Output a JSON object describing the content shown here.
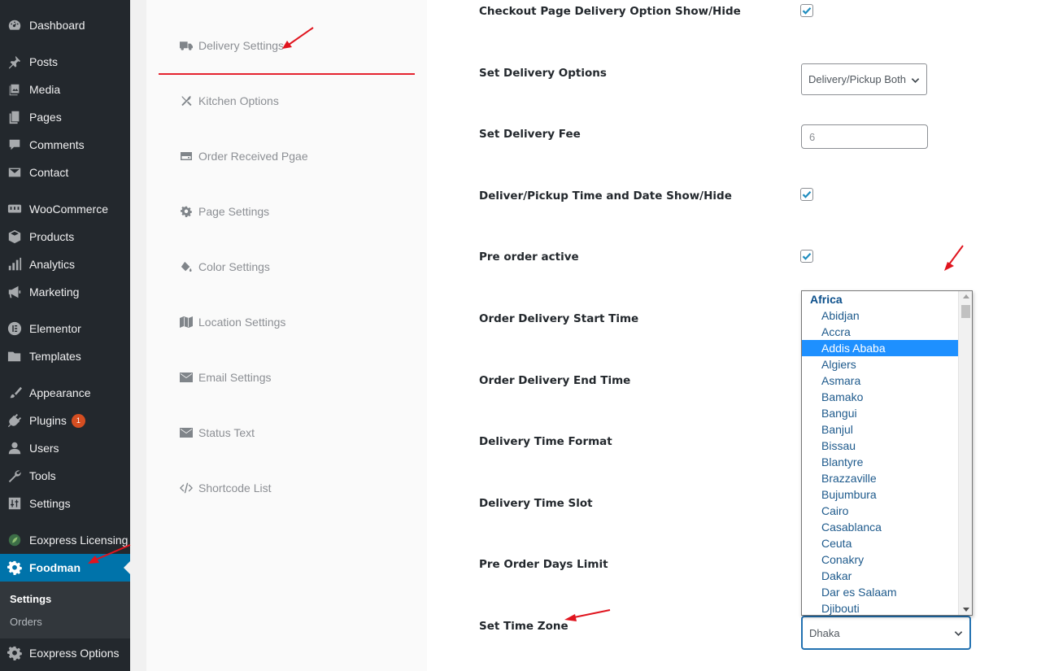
{
  "sidebar": {
    "items": [
      {
        "label": "Dashboard",
        "icon": "dashboard-icon"
      },
      {
        "label": "Posts",
        "icon": "pin-icon"
      },
      {
        "label": "Media",
        "icon": "media-icon"
      },
      {
        "label": "Pages",
        "icon": "pages-icon"
      },
      {
        "label": "Comments",
        "icon": "comment-icon"
      },
      {
        "label": "Contact",
        "icon": "envelope-icon"
      },
      {
        "label": "WooCommerce",
        "icon": "woo-icon"
      },
      {
        "label": "Products",
        "icon": "box-icon"
      },
      {
        "label": "Analytics",
        "icon": "bar-chart-icon"
      },
      {
        "label": "Marketing",
        "icon": "megaphone-icon"
      },
      {
        "label": "Elementor",
        "icon": "elementor-icon"
      },
      {
        "label": "Templates",
        "icon": "folder-icon"
      },
      {
        "label": "Appearance",
        "icon": "brush-icon"
      },
      {
        "label": "Plugins",
        "icon": "plug-icon",
        "badge": "1"
      },
      {
        "label": "Users",
        "icon": "user-icon"
      },
      {
        "label": "Tools",
        "icon": "wrench-icon"
      },
      {
        "label": "Settings",
        "icon": "sliders-icon"
      },
      {
        "label": "Eoxpress Licensing",
        "icon": "leaf-icon"
      },
      {
        "label": "Foodman",
        "icon": "gear-icon"
      },
      {
        "label": "Eoxpress Options",
        "icon": "gear-icon"
      }
    ],
    "submenu": [
      "Settings",
      "Orders"
    ]
  },
  "tabs": [
    {
      "label": "Delivery Settings",
      "icon": "truck-icon"
    },
    {
      "label": "Kitchen Options",
      "icon": "utensils-icon"
    },
    {
      "label": "Order Received Pgae",
      "icon": "hdd-icon"
    },
    {
      "label": "Page Settings",
      "icon": "gear-icon"
    },
    {
      "label": "Color Settings",
      "icon": "paint-bucket-icon"
    },
    {
      "label": "Location Settings",
      "icon": "map-icon"
    },
    {
      "label": "Email Settings",
      "icon": "envelope-icon"
    },
    {
      "label": "Status Text",
      "icon": "envelope-icon"
    },
    {
      "label": "Shortcode List",
      "icon": "code-icon"
    }
  ],
  "form": {
    "checkout_toggle_label": "Checkout Page Delivery Option Show/Hide",
    "delivery_options_label": "Set Delivery Options",
    "delivery_options_value": "Delivery/Pickup Both",
    "delivery_fee_label": "Set Delivery Fee",
    "delivery_fee_value": "6",
    "datetime_toggle_label": "Deliver/Pickup Time and Date Show/Hide",
    "preorder_label": "Pre order active",
    "start_time_label": "Order Delivery Start Time",
    "end_time_label": "Order Delivery End Time",
    "time_format_label": "Delivery Time Format",
    "time_slot_label": "Delivery Time Slot",
    "preorder_days_label": "Pre Order Days Limit",
    "timezone_label": "Set Time Zone",
    "timezone_value": "Dhaka"
  },
  "timezone_dropdown": {
    "group": "Africa",
    "options": [
      "Abidjan",
      "Accra",
      "Addis Ababa",
      "Algiers",
      "Asmara",
      "Bamako",
      "Bangui",
      "Banjul",
      "Bissau",
      "Blantyre",
      "Brazzaville",
      "Bujumbura",
      "Cairo",
      "Casablanca",
      "Ceuta",
      "Conakry",
      "Dakar",
      "Dar es Salaam",
      "Djibouti"
    ],
    "selected": "Addis Ababa"
  },
  "colors": {
    "sidebar_bg": "#23282d",
    "active_menu": "#0073aa",
    "tab_underline": "#e5232f",
    "checkbox_check": "#1e8cbe",
    "dropdown_highlight": "#1e90ff",
    "annotation_arrow": "#e0141e"
  }
}
